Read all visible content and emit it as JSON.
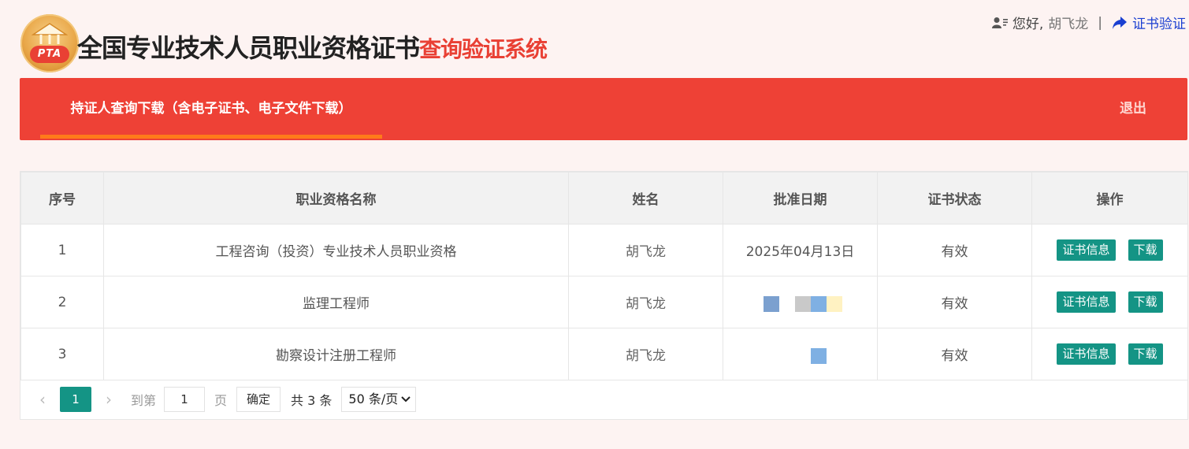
{
  "header": {
    "logo_text": "PTA",
    "title_main": "全国专业技术人员职业资格证书",
    "title_sub": "查询验证系统",
    "greeting": "您好,",
    "username": "胡飞龙",
    "separator": "|",
    "verify_link": "证书验证"
  },
  "nav": {
    "active_tab": "持证人查询下载（含电子证书、电子文件下载）",
    "logout": "退出"
  },
  "table": {
    "columns": [
      "序号",
      "职业资格名称",
      "姓名",
      "批准日期",
      "证书状态",
      "操作"
    ],
    "rows": [
      {
        "index": "1",
        "name": "工程咨询（投资）专业技术人员职业资格",
        "holder": "胡飞龙",
        "date": "2025年04月13日",
        "status": "有效",
        "btn_info": "证书信息",
        "btn_download": "下载"
      },
      {
        "index": "2",
        "name": "监理工程师",
        "holder": "胡飞龙",
        "date": "",
        "status": "有效",
        "btn_info": "证书信息",
        "btn_download": "下载"
      },
      {
        "index": "3",
        "name": "勘察设计注册工程师",
        "holder": "胡飞龙",
        "date": "",
        "status": "有效",
        "btn_info": "证书信息",
        "btn_download": "下载"
      }
    ]
  },
  "pager": {
    "current_page": "1",
    "goto_label": "到第",
    "page_input": "1",
    "page_label": "页",
    "confirm": "确定",
    "total": "共 3 条",
    "page_size": "50 条/页"
  },
  "colors": {
    "brand_red": "#ee4136",
    "tab_underline": "#ff7a1a",
    "action_teal": "#149485",
    "link_blue": "#1a3fd1"
  }
}
